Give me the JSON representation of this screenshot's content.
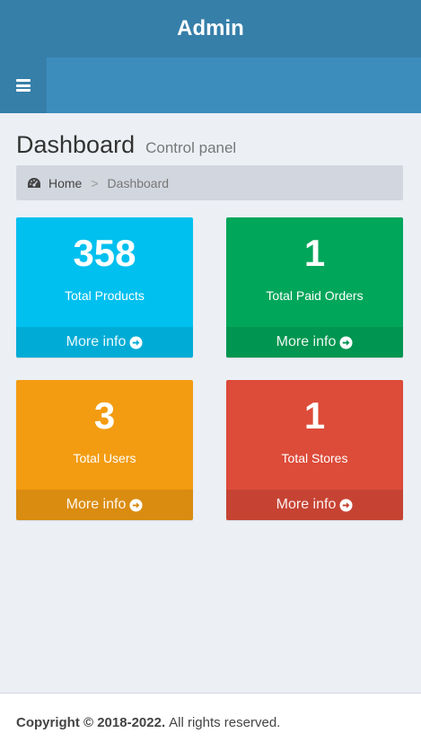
{
  "header": {
    "logo": "Admin",
    "brand_color": "#367fa9",
    "navbar_color": "#3c8dbc",
    "toggle_icon": "hamburger-menu-icon"
  },
  "content_header": {
    "title": "Dashboard",
    "subtitle": "Control panel"
  },
  "breadcrumb": {
    "icon": "dashboard-gauge-icon",
    "home": "Home",
    "separator": ">",
    "current": "Dashboard"
  },
  "stat_boxes": [
    {
      "value": "358",
      "label": "Total Products",
      "link": "More info",
      "color": "#00c0ef"
    },
    {
      "value": "1",
      "label": "Total Paid Orders",
      "link": "More info",
      "color": "#00a65a"
    },
    {
      "value": "3",
      "label": "Total Users",
      "link": "More info",
      "color": "#f39c12"
    },
    {
      "value": "1",
      "label": "Total Stores",
      "link": "More info",
      "color": "#dd4b39"
    }
  ],
  "footer": {
    "copyright": "Copyright © 2018-2022.",
    "rights": "All rights reserved."
  }
}
